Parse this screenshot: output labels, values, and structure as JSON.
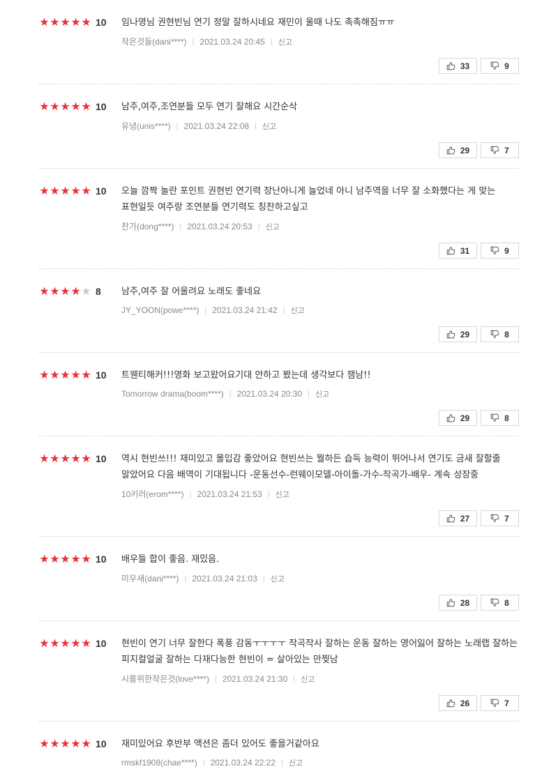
{
  "accent_color": "#e8303a",
  "report_label": "신고",
  "icons": {
    "like": "thumbs-up-icon",
    "dislike": "thumbs-down-icon",
    "star": "star-icon"
  },
  "reviews": [
    {
      "stars": 5,
      "score": "10",
      "text": "임나영님 권현빈님 연기 정말 잘하시네요 재민이 울때 나도 촉촉해짐ㅠㅠ",
      "author": "작은것들(dani****)",
      "date": "2021.03.24 20:45",
      "likes": "33",
      "dislikes": "9"
    },
    {
      "stars": 5,
      "score": "10",
      "text": "남주,여주,조연분들 모두 연기 잘해요 시간순삭",
      "author": "유녕(unis****)",
      "date": "2021.03.24 22:08",
      "likes": "29",
      "dislikes": "7"
    },
    {
      "stars": 5,
      "score": "10",
      "text": "오늘 깜짝 놀란 포인트 권현빈 연기력 장난아니게 늘었네 아니 남주역을 너무 잘 소화했다는 게 맞는 표현일듯 여주랑 조연분들 연기력도 칭찬하고싶고",
      "author": "찬가(dong****)",
      "date": "2021.03.24 20:53",
      "likes": "31",
      "dislikes": "9"
    },
    {
      "stars": 4,
      "score": "8",
      "text": "남주,여주 잘 어울려요 노래도 좋네요",
      "author": "JY_YOON(powe****)",
      "date": "2021.03.24 21:42",
      "likes": "29",
      "dislikes": "8"
    },
    {
      "stars": 5,
      "score": "10",
      "text": "트웬티해커!!!영화 보고왔어요기대 안하고 봤는데 생각보다 잼남!!",
      "author": "Tomorrow drama(boom****)",
      "date": "2021.03.24 20:30",
      "likes": "29",
      "dislikes": "8"
    },
    {
      "stars": 5,
      "score": "10",
      "text": "역시 현빈쓰!!! 재미있고 몰입감 좋았어요 현빈쓰는 뭘하든 습득 능력이 뛰어나서 연기도 금새 잘할줄 알았어요 다음 배역이 기대됩니다 -운동선수-런웨이모델-아이돌-가수-작곡가-배우- 계속 성장중",
      "author": "10키러(erom****)",
      "date": "2021.03.24 21:53",
      "likes": "27",
      "dislikes": "7"
    },
    {
      "stars": 5,
      "score": "10",
      "text": "배우들 합이 좋음. 재밌음.",
      "author": "미우새(dani****)",
      "date": "2021.03.24 21:03",
      "likes": "28",
      "dislikes": "8"
    },
    {
      "stars": 5,
      "score": "10",
      "text": "현빈이 연기 너무 잘한다 폭풍 감동ㅜㅜㅜㅜ 작곡작사 잘하는 운동 잘하는 영어잃어 잘하는 노래랩 잘하는 피지컬얼굴 잘하는 다재다능한 현빈이 = 살아있는 만찢남",
      "author": "시를위한작은것(love****)",
      "date": "2021.03.24 21:30",
      "likes": "26",
      "dislikes": "7"
    },
    {
      "stars": 5,
      "score": "10",
      "text": "재미있어요 후반부 액션은 좀더 있어도 좋을거같아요",
      "author": "rmskf1908(chae****)",
      "date": "2021.03.24 22:22",
      "likes": "",
      "dislikes": ""
    }
  ]
}
